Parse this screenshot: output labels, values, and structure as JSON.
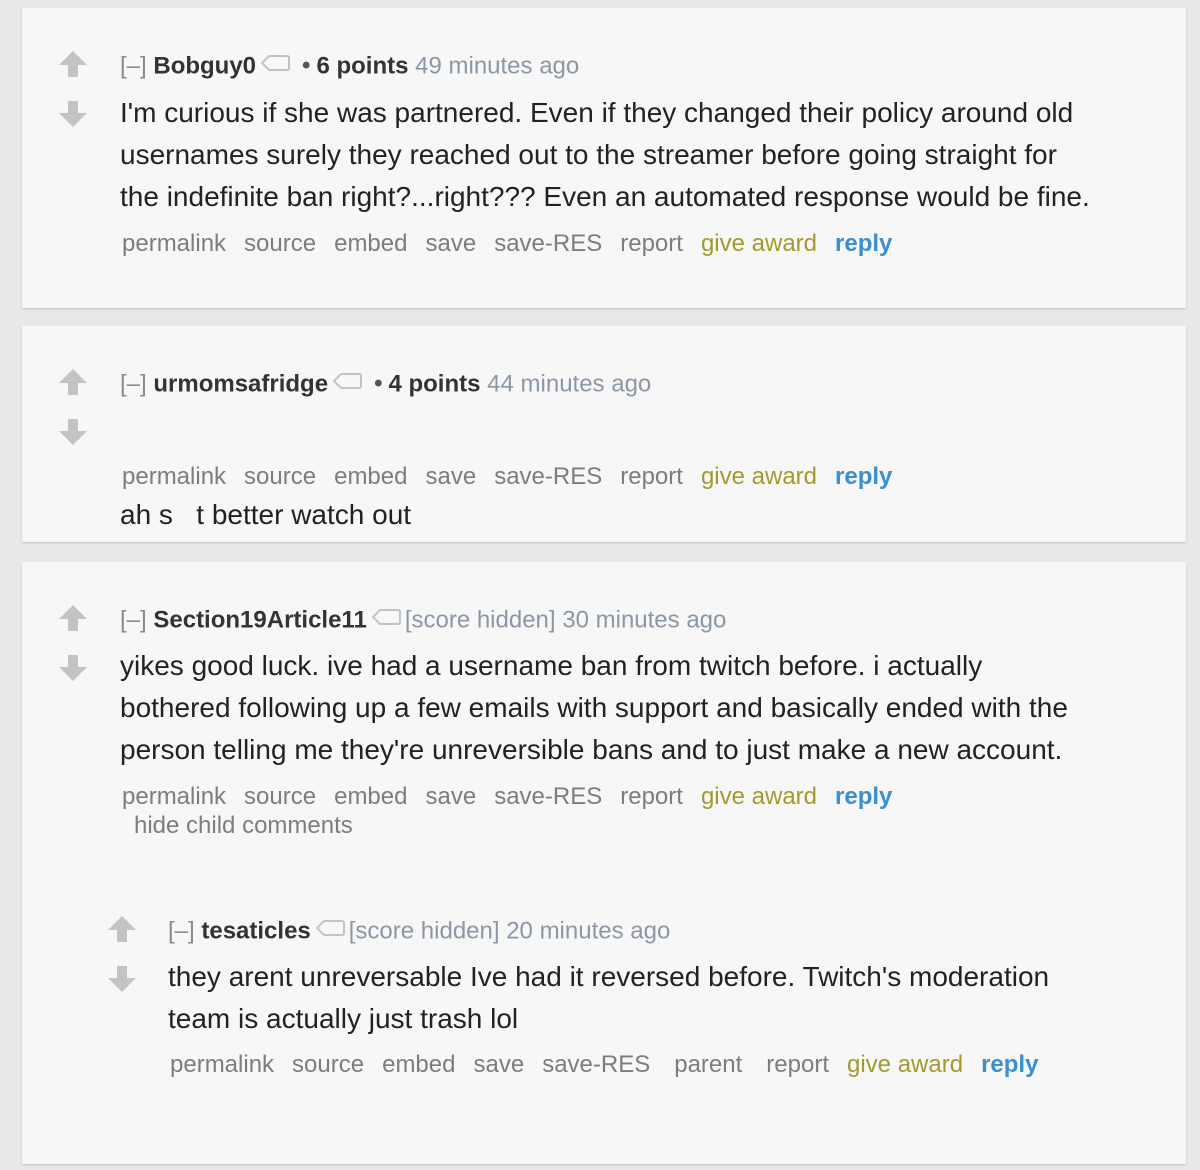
{
  "colors": {
    "background": "#e9e9e9",
    "card": "#f7f7f7",
    "author": "#333333",
    "timestamp": "#8c97a5",
    "action_link": "#7d7d7d",
    "give_award": "#a39a2d",
    "reply": "#3a8fd0",
    "vote_arrow": "#c3c3c3"
  },
  "comments": [
    {
      "toggle": "[–]",
      "author": "Bobguy0",
      "icon": "tag-icon",
      "score": "6 points",
      "time": "49 minutes ago",
      "lines": [
        "I'm curious if she was partnered. Even if they changed their policy around old",
        "usernames surely they reached out to the streamer before going straight for",
        "the indefinite ban right?...right??? Even an automated response would be fine."
      ],
      "actions": [
        "permalink",
        "source",
        "embed",
        "save",
        "save-RES",
        "report",
        "give award",
        "reply"
      ]
    },
    {
      "toggle": "[–]",
      "author": "urmomsafridge",
      "icon": "tag-icon",
      "score": "4 points",
      "time": "44 minutes ago",
      "lines": [
        "ah s   t better watch out"
      ],
      "actions": [
        "permalink",
        "source",
        "embed",
        "save",
        "save-RES",
        "report",
        "give award",
        "reply"
      ]
    },
    {
      "toggle": "[–]",
      "author": "Section19Article11",
      "icon": "tag-icon",
      "score_hidden": "[score hidden]",
      "time": "30 minutes ago",
      "lines": [
        "yikes good luck. ive had a username ban from twitch before. i actually",
        "bothered following up a few emails with support and basically ended with the",
        "person telling me they're unreversible bans and to just make a new account."
      ],
      "actions": [
        "permalink",
        "source",
        "embed",
        "save",
        "save-RES",
        "report",
        "give award",
        "reply"
      ],
      "hide_child": "hide child comments"
    },
    {
      "toggle": "[–]",
      "author": "tesaticles",
      "icon": "tag-icon",
      "score_hidden": "[score hidden]",
      "time": "20 minutes ago",
      "lines": [
        "they arent unreversable Ive had it reversed before. Twitch's moderation",
        "team is actually just trash lol"
      ],
      "actions": [
        "permalink",
        "source",
        "embed",
        "save",
        "save-RES",
        "parent",
        "report",
        "give award",
        "reply"
      ]
    }
  ]
}
